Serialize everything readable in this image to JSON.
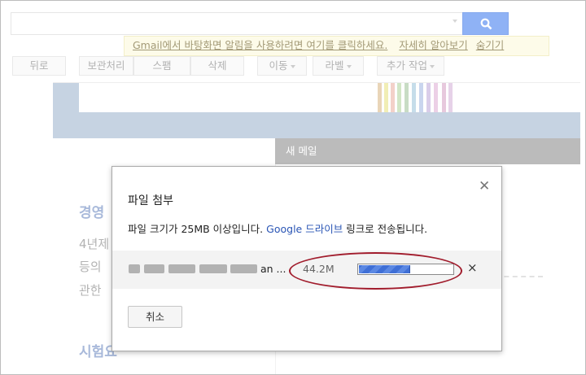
{
  "notification": {
    "gmail_word": "Gmail",
    "message": "에서 바탕화면 알림을 사용하려면 여기를 클릭하세요.",
    "learn_more": "자세히 알아보기",
    "hide": "숨기기"
  },
  "toolbar": {
    "back": "뒤로",
    "archive": "보관처리",
    "spam": "스팸",
    "delete": "삭제",
    "move": "이동",
    "labels": "라벨",
    "more": "추가 작업"
  },
  "compose_bar": {
    "title": "새 메일"
  },
  "background_text": {
    "heading1": "경영",
    "line1": "4년제",
    "line2": "등의",
    "line3": "관한",
    "heading2": "시험요"
  },
  "dialog": {
    "title": "파일 첨부",
    "close_icon": "close-icon",
    "message_prefix": "파일 크기가 25MB 이상입니다.",
    "message_link": "Google 드라이브",
    "message_suffix": "링크로 전송됩니다.",
    "file": {
      "name_suffix": "an ...",
      "size": "44.2M",
      "progress": 0.55,
      "cancel_icon": "close-icon"
    },
    "cancel_label": "취소"
  },
  "colors": {
    "annotation_oval": "#a11c2c",
    "progress_fill": "#3f6fd6",
    "link": "#2a55b5",
    "banner": "#c6d3e2"
  }
}
